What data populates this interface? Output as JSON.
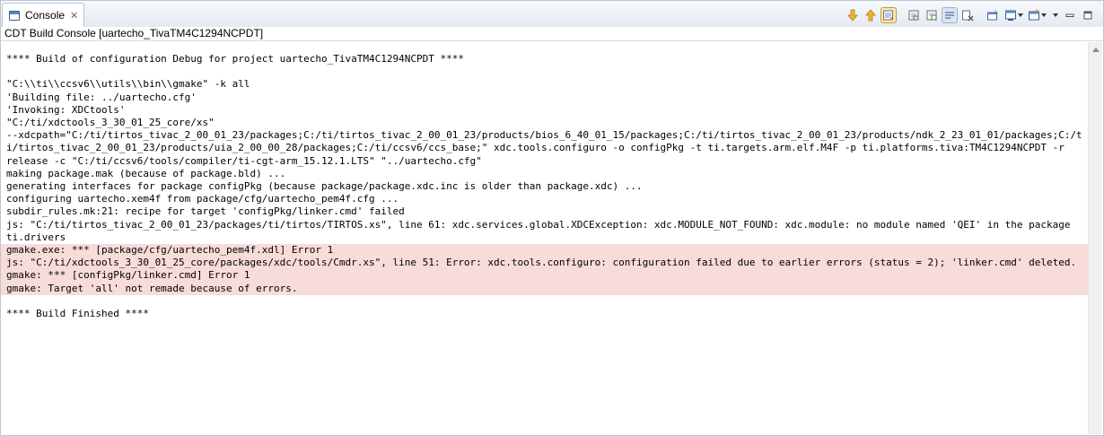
{
  "tab": {
    "label": "Console",
    "icon": "console-icon",
    "close_icon": "close-icon"
  },
  "toolbar": {
    "buttons": [
      {
        "name": "next-error-icon"
      },
      {
        "name": "previous-error-icon"
      },
      {
        "name": "scroll-lock-icon",
        "pressed": true
      },
      {
        "name": "clear-console-icon"
      },
      {
        "name": "copy-build-log-icon"
      },
      {
        "name": "word-wrap-icon",
        "pressed": true
      },
      {
        "name": "remove-launch-icon"
      },
      {
        "name": "pin-console-icon"
      },
      {
        "name": "display-selected-console-icon",
        "dropdown": true
      },
      {
        "name": "open-console-icon",
        "dropdown": true
      },
      {
        "name": "view-menu-icon"
      },
      {
        "name": "minimize-icon"
      },
      {
        "name": "maximize-icon"
      }
    ]
  },
  "subtitle": "CDT Build Console [uartecho_TivaTM4C1294NCPDT]",
  "lines": [
    {
      "text": "**** Build of configuration Debug for project uartecho_TivaTM4C1294NCPDT ****",
      "error": false
    },
    {
      "text": "",
      "error": false
    },
    {
      "text": "\"C:\\\\ti\\\\ccsv6\\\\utils\\\\bin\\\\gmake\" -k all",
      "error": false
    },
    {
      "text": "'Building file: ../uartecho.cfg'",
      "error": false
    },
    {
      "text": "'Invoking: XDCtools'",
      "error": false
    },
    {
      "text": "\"C:/ti/xdctools_3_30_01_25_core/xs\"",
      "error": false
    },
    {
      "text": "--xdcpath=\"C:/ti/tirtos_tivac_2_00_01_23/packages;C:/ti/tirtos_tivac_2_00_01_23/products/bios_6_40_01_15/packages;C:/ti/tirtos_tivac_2_00_01_23/products/ndk_2_23_01_01/packages;C:/t",
      "error": false
    },
    {
      "text": "i/tirtos_tivac_2_00_01_23/products/uia_2_00_00_28/packages;C:/ti/ccsv6/ccs_base;\" xdc.tools.configuro -o configPkg -t ti.targets.arm.elf.M4F -p ti.platforms.tiva:TM4C1294NCPDT -r",
      "error": false
    },
    {
      "text": "release -c \"C:/ti/ccsv6/tools/compiler/ti-cgt-arm_15.12.1.LTS\" \"../uartecho.cfg\"",
      "error": false
    },
    {
      "text": "making package.mak (because of package.bld) ...",
      "error": false
    },
    {
      "text": "generating interfaces for package configPkg (because package/package.xdc.inc is older than package.xdc) ...",
      "error": false
    },
    {
      "text": "configuring uartecho.xem4f from package/cfg/uartecho_pem4f.cfg ...",
      "error": false
    },
    {
      "text": "subdir_rules.mk:21: recipe for target 'configPkg/linker.cmd' failed",
      "error": false
    },
    {
      "text": "js: \"C:/ti/tirtos_tivac_2_00_01_23/packages/ti/tirtos/TIRTOS.xs\", line 61: xdc.services.global.XDCException: xdc.MODULE_NOT_FOUND: xdc.module: no module named 'QEI' in the package",
      "error": false
    },
    {
      "text": "ti.drivers",
      "error": false
    },
    {
      "text": "gmake.exe: *** [package/cfg/uartecho_pem4f.xdl] Error 1",
      "error": true
    },
    {
      "text": "js: \"C:/ti/xdctools_3_30_01_25_core/packages/xdc/tools/Cmdr.xs\", line 51: Error: xdc.tools.configuro: configuration failed due to earlier errors (status = 2); 'linker.cmd' deleted.",
      "error": true
    },
    {
      "text": "gmake: *** [configPkg/linker.cmd] Error 1",
      "error": true
    },
    {
      "text": "gmake: Target 'all' not remade because of errors.",
      "error": true
    },
    {
      "text": "",
      "error": false
    },
    {
      "text": "**** Build Finished ****",
      "error": false
    }
  ],
  "colors": {
    "error_highlight": "#f7dcd9",
    "border": "#b9c6d8"
  }
}
